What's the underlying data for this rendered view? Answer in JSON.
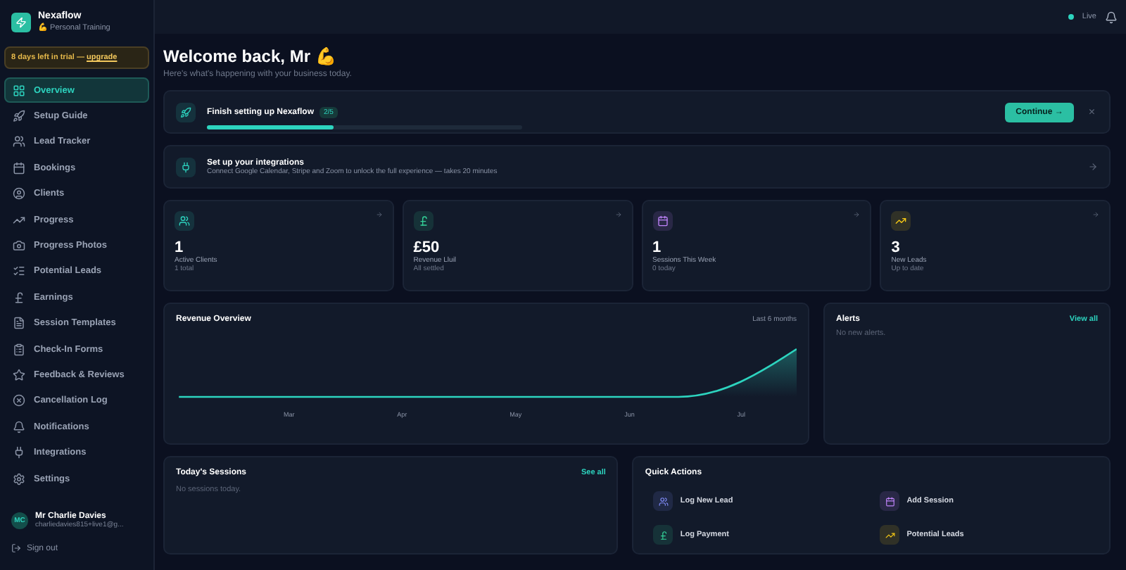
{
  "brand": {
    "name": "Nexaflow",
    "subtitle": "💪 Personal Training"
  },
  "trial": {
    "text": "8 days left in trial — ",
    "link": "upgrade"
  },
  "nav": [
    {
      "label": "Overview",
      "selected": true
    },
    {
      "label": "Setup Guide",
      "selected": false
    },
    {
      "label": "Lead Tracker",
      "selected": false
    },
    {
      "label": "Bookings",
      "selected": false
    },
    {
      "label": "Clients",
      "selected": false
    },
    {
      "label": "Progress",
      "selected": false
    },
    {
      "label": "Progress Photos",
      "selected": false
    },
    {
      "label": "Potential Leads",
      "selected": false
    },
    {
      "label": "Earnings",
      "selected": false
    },
    {
      "label": "Session Templates",
      "selected": false
    },
    {
      "label": "Check-In Forms",
      "selected": false
    },
    {
      "label": "Feedback & Reviews",
      "selected": false
    },
    {
      "label": "Cancellation Log",
      "selected": false
    },
    {
      "label": "Notifications",
      "selected": false
    },
    {
      "label": "Integrations",
      "selected": false
    },
    {
      "label": "Settings",
      "selected": false
    }
  ],
  "user": {
    "initials": "MC",
    "name": "Mr Charlie Davies",
    "email": "charliedavies815+live1@g..."
  },
  "sign_out": "Sign out",
  "topbar": {
    "status": "Live"
  },
  "welcome": {
    "title": "Welcome back, Mr 💪",
    "subtitle": "Here's what's happening with your business today."
  },
  "setup": {
    "title": "Finish setting up Nexaflow",
    "count": "2/5",
    "level": 0.4,
    "button": "Continue →",
    "close": "×"
  },
  "integrations": {
    "title": "Set up your integrations",
    "text": "Connect Google Calendar, Stripe and Zoom to unlock the full experience — takes 20 minutes"
  },
  "stats": [
    {
      "color": "#2dd4bf",
      "value": "1",
      "label": "Active Clients",
      "note": "1 total"
    },
    {
      "color": "#34d399",
      "value": "£50",
      "label": "Revenue Lluil",
      "note": "All settled"
    },
    {
      "color": "#c084fc",
      "value": "1",
      "label": "Sessions This Week",
      "note": "0 today"
    },
    {
      "color": "#facc15",
      "value": "3",
      "label": "New Leads",
      "note": "Up to date"
    }
  ],
  "revenue": {
    "title": "Revenue Overview",
    "range": "Last 6 months",
    "months": [
      "Mar",
      "Apr",
      "May",
      "Jun",
      "Jul"
    ]
  },
  "alerts": {
    "title": "Alerts",
    "link": "View all",
    "empty": "No new alerts."
  },
  "sessions": {
    "title": "Today's Sessions",
    "link": "See all",
    "empty": "No sessions today."
  },
  "quick": {
    "title": "Quick Actions",
    "actions": [
      {
        "label": "Log New Lead",
        "color": "#818cf8"
      },
      {
        "label": "Add Session",
        "color": "#c084fc"
      },
      {
        "label": "Log Payment",
        "color": "#34d399"
      },
      {
        "label": "Potential Leads",
        "color": "#facc15"
      }
    ]
  }
}
